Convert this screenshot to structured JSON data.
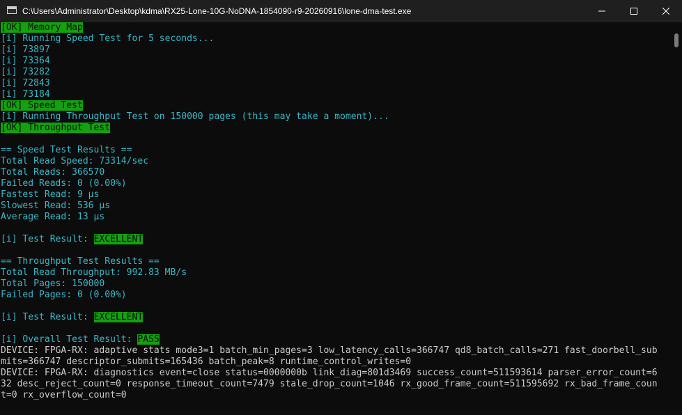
{
  "window": {
    "title": "C:\\Users\\Administrator\\Desktop\\kdma\\RX25-Lone-10G-NoDNA-1854090-r9-20260916\\lone-dma-test.exe",
    "icon": "console-app-icon",
    "controls": [
      "minimize-icon",
      "maximize-icon",
      "close-icon"
    ]
  },
  "console": {
    "l0_tag": "[OK]",
    "l0_text": " Memory Map",
    "l1": "[i] Running Speed Test for 5 seconds...",
    "l2": "[i] 73897",
    "l3": "[i] 73364",
    "l4": "[i] 73282",
    "l5": "[i] 72843",
    "l6": "[i] 73184",
    "l7_tag": "[OK]",
    "l7_text": " Speed Test",
    "l8": "[i] Running Throughput Test on 150000 pages (this may take a moment)...",
    "l9_tag": "[OK]",
    "l9_text": " Throughput Test",
    "l10": "",
    "l11": "== Speed Test Results ==",
    "l12": "Total Read Speed: 73314/sec",
    "l13": "Total Reads: 366570",
    "l14": "Failed Reads: 0 (0.00%)",
    "l15": "Fastest Read: 9 μs",
    "l16": "Slowest Read: 536 μs",
    "l17": "Average Read: 13 μs",
    "l18": "",
    "l19_prefix": "[i] Test Result: ",
    "l19_result": "EXCELLENT",
    "l20": "",
    "l21": "== Throughput Test Results ==",
    "l22": "Total Read Throughput: 992.83 MB/s",
    "l23": "Total Pages: 150000",
    "l24": "Failed Pages: 0 (0.00%)",
    "l25": "",
    "l26_prefix": "[i] Test Result: ",
    "l26_result": "EXCELLENT",
    "l27": "",
    "l28_prefix": "[i] Overall Test Result: ",
    "l28_result": "PASS",
    "l29": "DEVICE: FPGA-RX: adaptive stats mode3=1 batch_min_pages=3 low_latency_calls=366747 qd8_batch_calls=271 fast_doorbell_sub",
    "l30": "mits=366747 descriptor_submits=165436 batch_peak=8 runtime_control_writes=0",
    "l31": "DEVICE: FPGA-RX: diagnostics event=close status=0000000b link_diag=801d3469 success_count=511593614 parser_error_count=6",
    "l32": "32 desc_reject_count=0 response_timeout_count=7479 stale_drop_count=1046 rx_good_frame_count=511595692 rx_bad_frame_coun",
    "l33": "t=0 rx_overflow_count=0"
  },
  "colors": {
    "background": "#0c0c0c",
    "titlebar": "#1f1f1f",
    "text": "#cccccc",
    "info_text": "#3ab7c8",
    "ok_highlight": "#13a10e"
  }
}
